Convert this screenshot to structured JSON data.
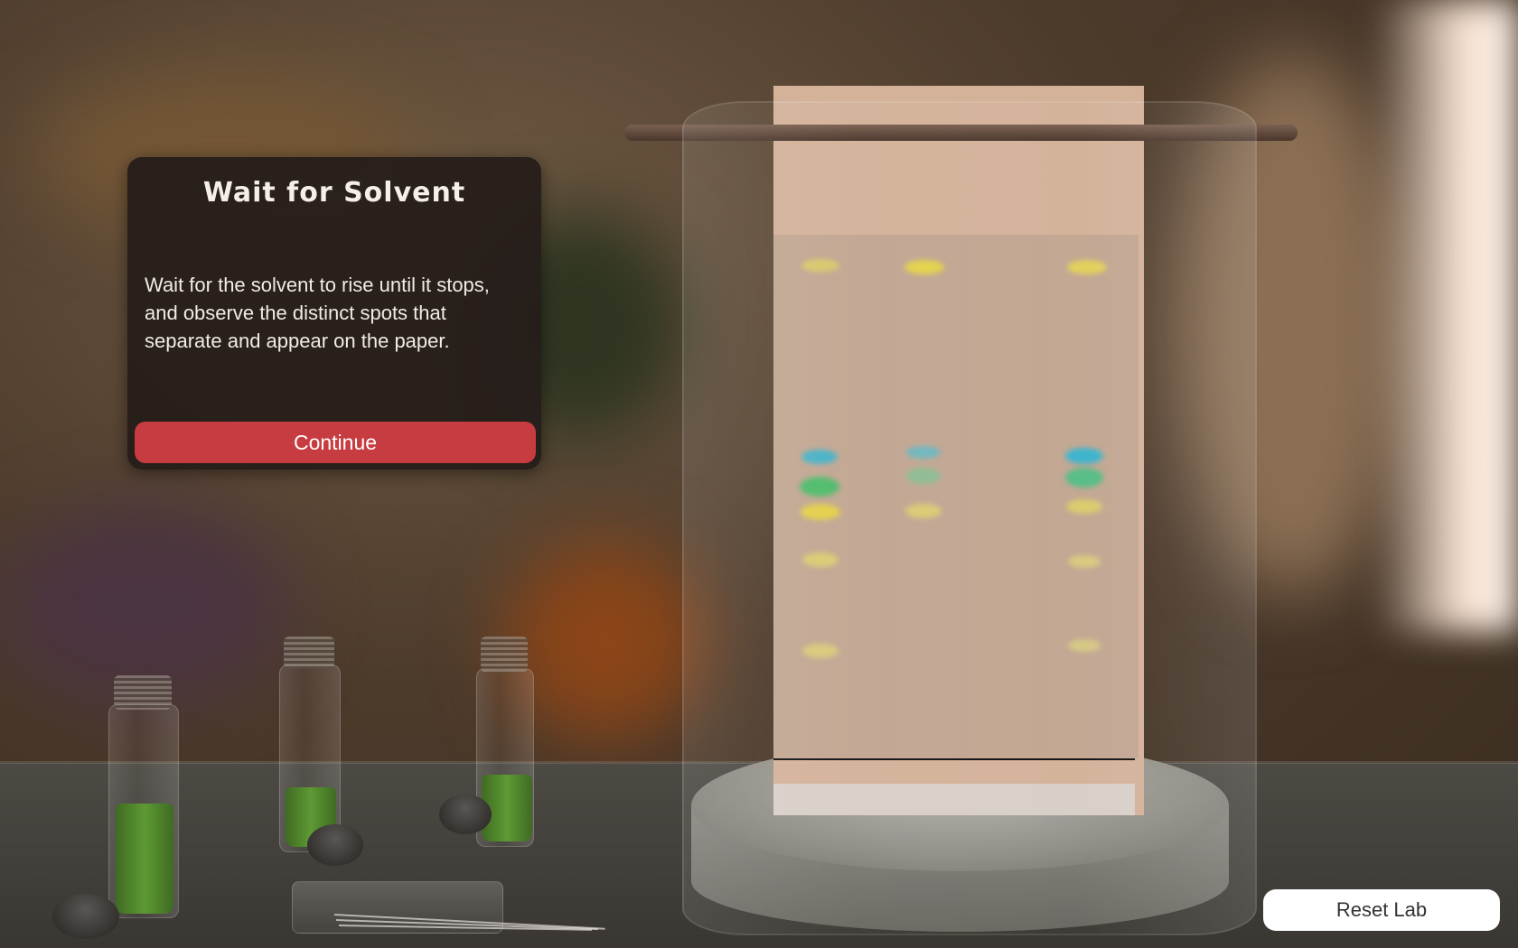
{
  "panel": {
    "title": "Wait for Solvent",
    "body": "Wait for the solvent to rise until it stops, and observe the distinct spots that separate and appear on the paper.",
    "continue_label": "Continue"
  },
  "reset_label": "Reset Lab"
}
